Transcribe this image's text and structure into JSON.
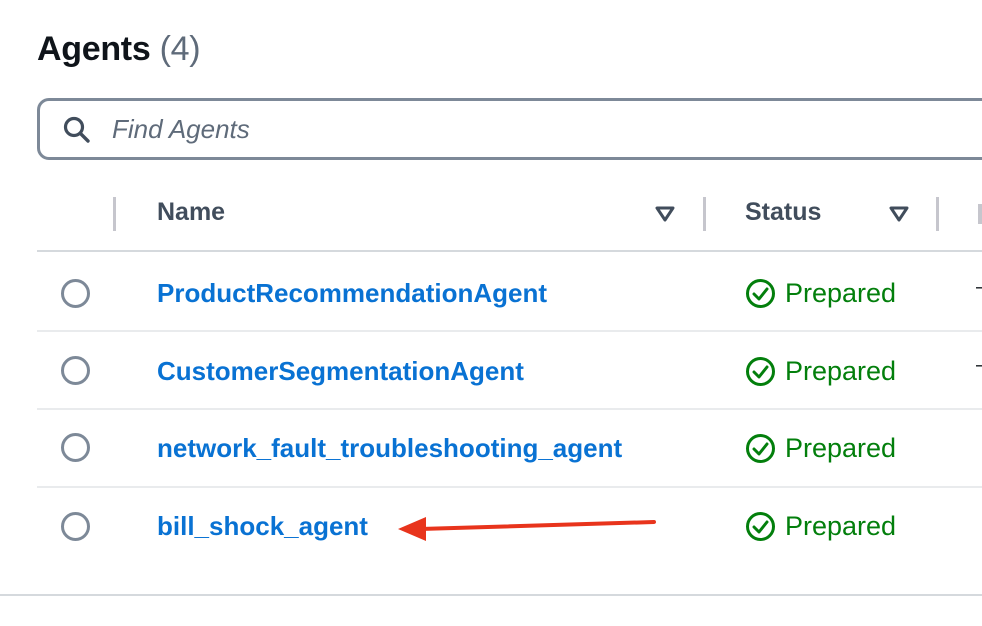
{
  "panel": {
    "title": "Agents",
    "count": "(4)"
  },
  "search": {
    "placeholder": "Find Agents",
    "value": ""
  },
  "table": {
    "columns": [
      {
        "label": "Name"
      },
      {
        "label": "Status"
      }
    ],
    "rows": [
      {
        "name": "ProductRecommendationAgent",
        "status": "Prepared"
      },
      {
        "name": "CustomerSegmentationAgent",
        "status": "Prepared"
      },
      {
        "name": "network_fault_troubleshooting_agent",
        "status": "Prepared"
      },
      {
        "name": "bill_shock_agent",
        "status": "Prepared"
      }
    ]
  },
  "colors": {
    "link": "#0972d3",
    "status_success": "#037f0c",
    "annotation_arrow": "#e8341c"
  },
  "icons": {
    "search": "search-icon",
    "sort": "caret-down-filled-icon",
    "status": "status-check-circle-icon",
    "annotation": "red-arrow-annotation"
  }
}
